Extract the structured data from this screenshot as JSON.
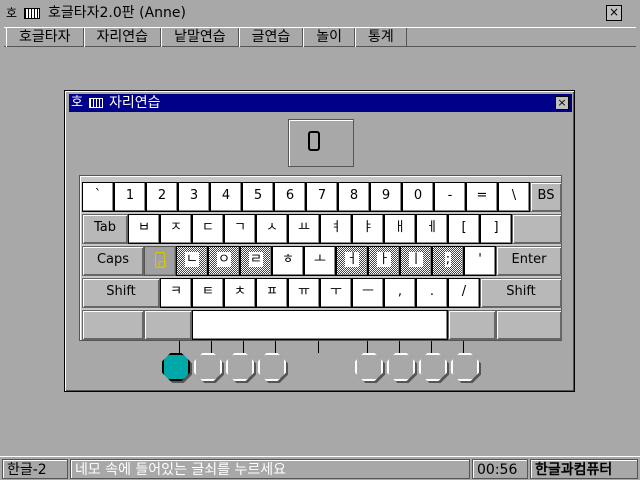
{
  "app": {
    "title": "호글타자2.0판 (Anne)",
    "icon_char": "호"
  },
  "menu": [
    "호글타자",
    "자리연습",
    "낱말연습",
    "글연습",
    "놀이",
    "통계"
  ],
  "dialog": {
    "title": "자리연습",
    "icon_char": "호",
    "close": "×",
    "target_char": "ㅇ"
  },
  "keyboard": {
    "row1": [
      "`",
      "1",
      "2",
      "3",
      "4",
      "5",
      "6",
      "7",
      "8",
      "9",
      "0",
      "-",
      "=",
      "\\",
      "BS"
    ],
    "row2": [
      "Tab",
      "ㅂ",
      "ㅈ",
      "ㄷ",
      "ㄱ",
      "ㅅ",
      "ㅛ",
      "ㅕ",
      "ㅑ",
      "ㅐ",
      "ㅔ",
      "[",
      "]"
    ],
    "row3": [
      "Caps",
      "ㅁ",
      "ㄴ",
      "ㅇ",
      "ㄹ",
      "ㅎ",
      "ㅗ",
      "ㅓ",
      "ㅏ",
      "ㅣ",
      ";",
      "'",
      "Enter"
    ],
    "row4": [
      "Shift",
      "ㅋ",
      "ㅌ",
      "ㅊ",
      "ㅍ",
      "ㅠ",
      "ㅜ",
      "ㅡ",
      ",",
      ".",
      "/",
      "Shift"
    ]
  },
  "fingers": {
    "active_index": 0,
    "count": 8
  },
  "status": {
    "mode": "한글-2",
    "message": "네모 속에 들어있는 글쇠를 누르세요",
    "time": "00:56",
    "company": "한글과컴퓨터"
  },
  "colors": {
    "dialog_title_bg": "#000088",
    "active_finger": "#00a8a8",
    "highlight_key_char": "#d4c800"
  }
}
